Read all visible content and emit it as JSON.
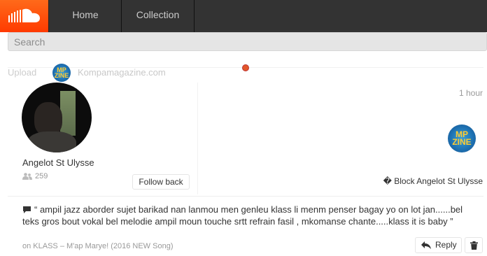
{
  "header": {
    "logo_icon": "soundcloud-cloud-icon",
    "nav": [
      {
        "label": "Home"
      },
      {
        "label": "Collection"
      }
    ]
  },
  "search": {
    "placeholder": "Search",
    "value": ""
  },
  "upload_row": {
    "label": "Upload",
    "source_avatar_text": "MP ZINE",
    "source_name": "Kompamagazine.com"
  },
  "profile": {
    "name": "Angelot St Ulysse",
    "followers_icon": "users-icon",
    "followers_count": "259",
    "follow_button": "Follow back"
  },
  "notification": {
    "time": "1 hour",
    "block_label": "� Block Angelot St Ulysse"
  },
  "comment": {
    "icon": "speech-bubble-icon",
    "text": "“ ampil jazz aborder sujet barikad nan lanmou men genleu klass li menm penser bagay yo on lot jan......bel teks gros bout vokal bel melodie ampil moun touche srtt refrain fasil , mkomanse chante.....klass it is baby ”",
    "on_track": "on KLASS – M'ap Marye! (2016 NEW Song)",
    "reply_label": "Reply",
    "delete_icon": "trash-icon"
  },
  "colors": {
    "header_bg": "#333333",
    "brand_orange": "#ff5500",
    "red_dot": "#e2572b"
  }
}
